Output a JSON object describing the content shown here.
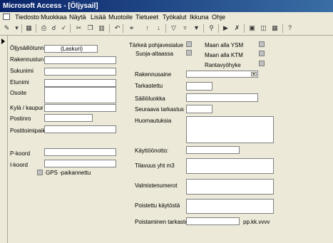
{
  "window": {
    "title": "Microsoft Access - [Öljysail]"
  },
  "menu": [
    "Tiedosto",
    "Muokkaa",
    "Näytä",
    "Lisää",
    "Muotoile",
    "Tietueet",
    "Työkalut",
    "Ikkuna",
    "Ohje"
  ],
  "toolbar": {
    "icons": [
      "design-view-icon",
      "save-icon",
      "print-icon",
      "print-preview-icon",
      "spelling-icon",
      "cut-icon",
      "copy-icon",
      "paste-icon",
      "undo-icon",
      "sort-ascending-icon",
      "sort-descending-icon",
      "filter-by-selection-icon",
      "filter-by-form-icon",
      "apply-filter-icon",
      "find-icon",
      "new-record-icon",
      "delete-record-icon",
      "properties-icon",
      "database-window-icon",
      "new-object-icon",
      "help-icon"
    ]
  },
  "form": {
    "left": {
      "oljysailtunnus_label": "Öljysäiliötunnus",
      "oljysailtunnus_value": "(Laskuri)",
      "rakennustunnus_label": "Rakennustun",
      "sukunimi_label": "Sukunimi",
      "etunimi_label": "Etunimi",
      "osoite_label": "Osoite",
      "kyla_label": "Kylä / kaupur",
      "postinro_label": "Postinro",
      "postitoimipaikka_label": "Postitoimipaik",
      "pkoord_label": "P-koord",
      "ikoord_label": "I-koord",
      "gps_label": "GPS -paikannettu"
    },
    "right": {
      "tarkea_pohjavesialue_label": "Tärkeä pohjavesialue",
      "suoja_altaassa_label": "Suoja-altaassa",
      "maan_alla_ysm_label": "Maan alla YSM",
      "maan_alla_ktm_label": "Maan alla KTM",
      "rantavyohyke_label": "Rantavyöhyke",
      "rakennusaine_label": "Rakennusaine",
      "tarkastettu_label": "Tarkastettu",
      "sailioluokka_label": "Säiliöluokka",
      "seuraava_tarkastus_label": "Seuraava tarkastus",
      "huomautuksia_label": "Huomautuksia",
      "kayttoonotto_label": "Käyttöönotto:",
      "tilavuus_label": "Tilavuus yht m3",
      "valmistenumero_label": "Valmistenumerot",
      "poistettu_label": "Poistettu käytöstä",
      "poistaminen_label": "Poistaminen tarkastettu",
      "date_format_hint": "pp.kk.vvvv"
    }
  }
}
